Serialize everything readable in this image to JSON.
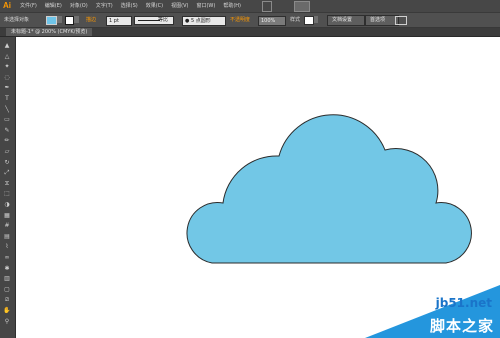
{
  "app": {
    "logo": "Ai"
  },
  "menu": {
    "items": [
      {
        "label": "文件(F)"
      },
      {
        "label": "编辑(E)"
      },
      {
        "label": "对象(O)"
      },
      {
        "label": "文字(T)"
      },
      {
        "label": "选择(S)"
      },
      {
        "label": "效果(C)"
      },
      {
        "label": "视图(V)"
      },
      {
        "label": "窗口(W)"
      },
      {
        "label": "帮助(H)"
      }
    ]
  },
  "control_bar": {
    "selection_label": "未选择对象",
    "stroke_label": "描边",
    "stroke_weight": "1 pt",
    "profile_label": "等比",
    "brush_label": "5 点圆形",
    "opacity_label": "不透明度",
    "opacity_value": "100%",
    "style_label": "样式",
    "doc_setup_button": "文档设置",
    "preferences_button": "首选项"
  },
  "document": {
    "tab_title": "未标题-1* @ 200% (CMYK/预览)"
  },
  "colors": {
    "cloud_fill": "#72c7e6",
    "cloud_stroke": "#2b2b2b",
    "fill_swatch": "#6fc4e8",
    "accent": "#ff9a00",
    "watermark_blue": "#1a74c9"
  },
  "tools": [
    "selection-icon",
    "direct-selection-icon",
    "magic-wand-icon",
    "lasso-icon",
    "pen-icon",
    "type-icon",
    "line-icon",
    "rectangle-icon",
    "paintbrush-icon",
    "pencil-icon",
    "eraser-icon",
    "rotate-icon",
    "scale-icon",
    "width-icon",
    "free-transform-icon",
    "shape-builder-icon",
    "perspective-icon",
    "mesh-icon",
    "gradient-icon",
    "eyedropper-icon",
    "blend-icon",
    "symbol-sprayer-icon",
    "graph-icon",
    "artboard-icon",
    "slice-icon",
    "hand-icon",
    "zoom-icon"
  ],
  "watermark": {
    "site": "jb51.net",
    "name": "脚本之家"
  }
}
